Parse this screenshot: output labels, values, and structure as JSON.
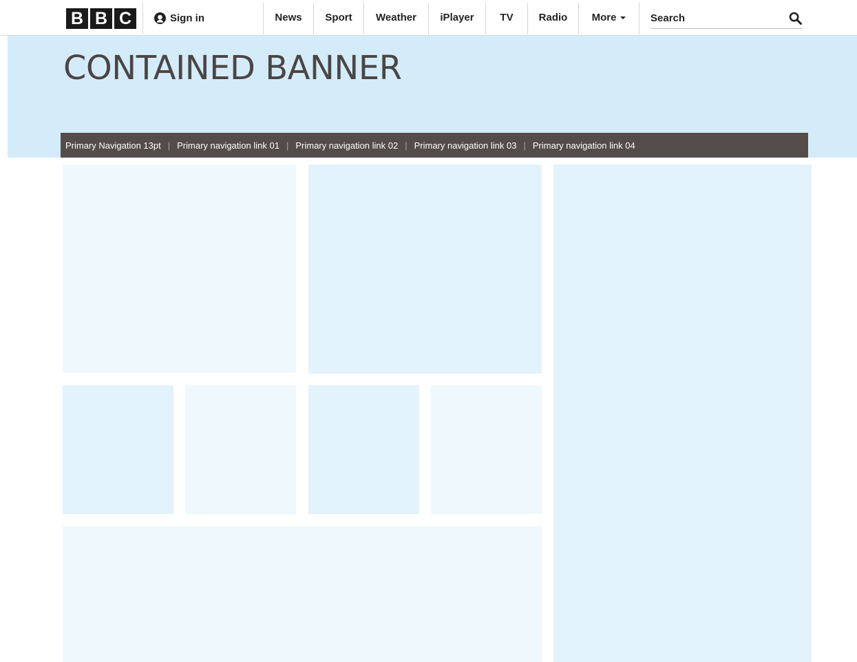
{
  "header": {
    "logo_letters": [
      "B",
      "B",
      "C"
    ],
    "sign_in": {
      "label": "Sign in",
      "icon": "user-icon"
    },
    "nav": [
      "News",
      "Sport",
      "Weather",
      "iPlayer",
      "TV",
      "Radio"
    ],
    "more": {
      "label": "More",
      "icon": "chevron-down-icon"
    },
    "search": {
      "placeholder": "Search",
      "value": "",
      "icon": "search-icon"
    }
  },
  "banner": {
    "title": "CONTAINED BANNER",
    "background_color": "#d4ebf9",
    "primary_nav": {
      "label": "Primary Navigation 13pt",
      "links": [
        "Primary navigation link 01",
        "Primary navigation link 02",
        "Primary navigation link 03",
        "Primary navigation link 04"
      ],
      "divider": "|",
      "background_color": "#534c48"
    }
  },
  "colors": {
    "block_light": "#eff8fd",
    "block_mid": "#e2f3fc",
    "text_dark": "#4a4645"
  }
}
